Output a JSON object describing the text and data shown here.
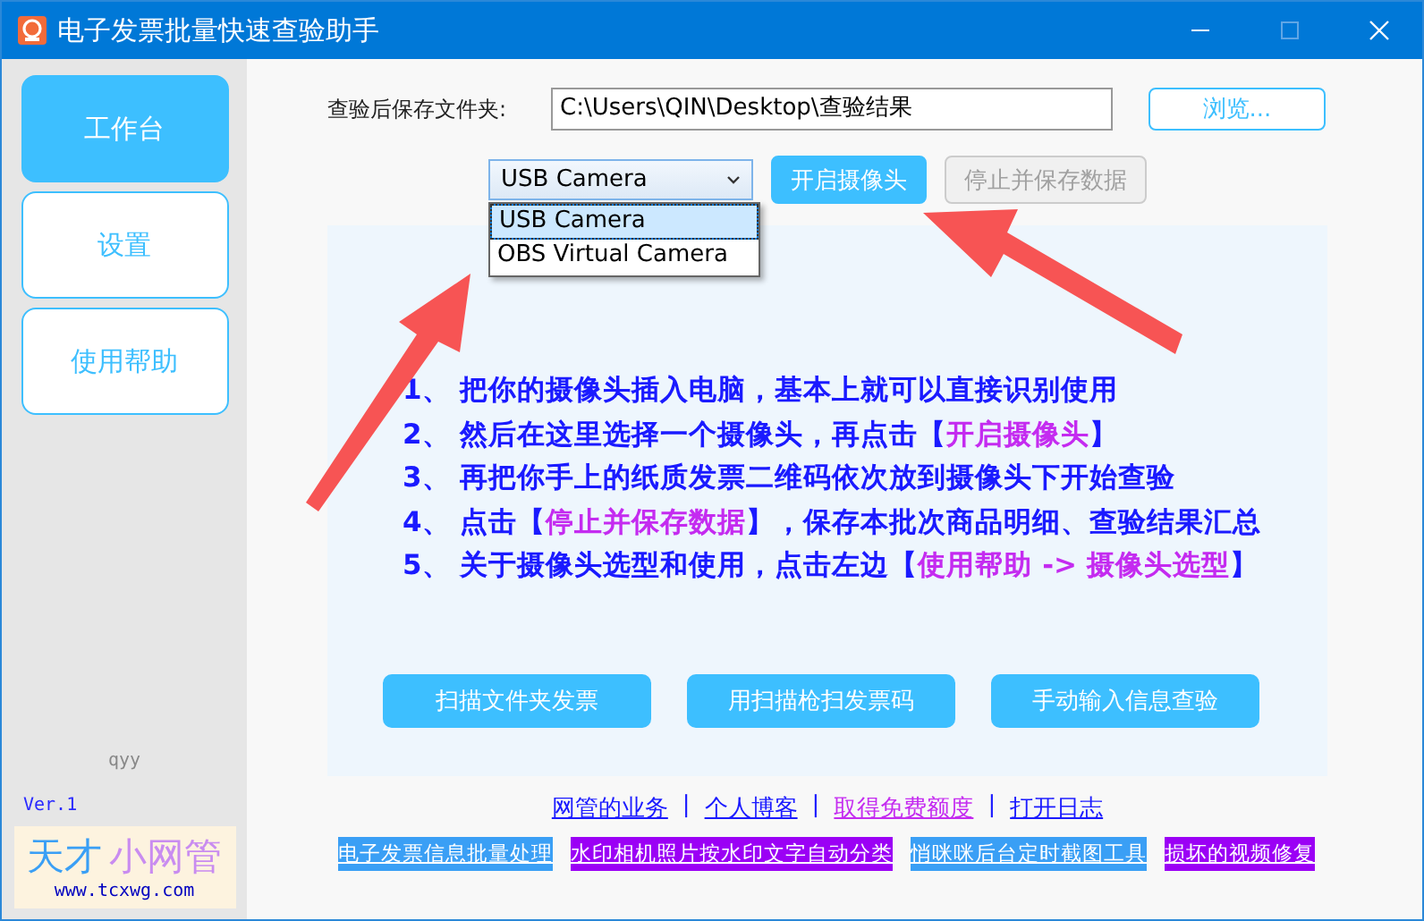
{
  "window": {
    "title": "电子发票批量快速查验助手"
  },
  "sidebar": {
    "items": [
      {
        "label": "工作台",
        "selected": true
      },
      {
        "label": "设置",
        "selected": false
      },
      {
        "label": "使用帮助",
        "selected": false
      }
    ],
    "author": "qyy",
    "version": "Ver.1",
    "logo": {
      "part_1": "天才",
      "part_2": "小网管",
      "url": "www.tcxwg.com"
    }
  },
  "folder": {
    "label": "查验后保存文件夹:",
    "value": "C:\\Users\\QIN\\Desktop\\查验结果",
    "browse_button": "浏览..."
  },
  "camera": {
    "value": "USB Camera",
    "expanded": true,
    "options": [
      {
        "label": "USB Camera",
        "selected": true
      },
      {
        "label": "OBS Virtual Camera",
        "selected": false
      }
    ],
    "start_button": {
      "label": "开启摄像头",
      "disabled": false
    },
    "stop_button": {
      "label": "停止并保存数据",
      "disabled": true
    }
  },
  "instructions": [
    [
      {
        "kind": "plain",
        "text": "1、 把你的摄像头插入电脑，基本上就可以直接识别使用"
      }
    ],
    [
      {
        "kind": "plain",
        "text": "2、 然后在这里选择一个摄像头，再点击【"
      },
      {
        "kind": "highlight",
        "text": "开启摄像头"
      },
      {
        "kind": "plain",
        "text": "】"
      }
    ],
    [
      {
        "kind": "plain",
        "text": "3、 再把你手上的纸质发票二维码依次放到摄像头下开始查验"
      }
    ],
    [
      {
        "kind": "plain",
        "text": "4、 点击【"
      },
      {
        "kind": "highlight",
        "text": "停止并保存数据"
      },
      {
        "kind": "plain",
        "text": "】，保存本批次商品明细、查验结果汇总"
      }
    ],
    [
      {
        "kind": "plain",
        "text": "5、 关于摄像头选型和使用，点击左边【"
      },
      {
        "kind": "highlight",
        "text": "使用帮助 -> 摄像头选型"
      },
      {
        "kind": "plain",
        "text": "】"
      }
    ]
  ],
  "action_buttons": [
    "扫描文件夹发票",
    "用扫描枪扫发票码",
    "手动输入信息查验"
  ],
  "link_separator": "|",
  "links": [
    {
      "label": "网管的业务",
      "kind": "plain"
    },
    {
      "label": "个人博客",
      "kind": "plain"
    },
    {
      "label": "取得免费额度",
      "kind": "highlight"
    },
    {
      "label": "打开日志",
      "kind": "plain"
    }
  ],
  "banners": [
    {
      "label": "电子发票信息批量处理",
      "color": "#3a9ff5"
    },
    {
      "label": "水印相机照片按水印文字自动分类",
      "color": "#9b00f5"
    },
    {
      "label": "悄咪咪后台定时截图工具",
      "color": "#3a9ff5"
    },
    {
      "label": "损坏的视频修复",
      "color": "#9b00f5"
    }
  ]
}
